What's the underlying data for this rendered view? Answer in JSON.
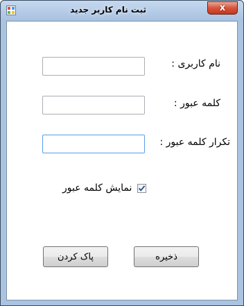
{
  "window": {
    "title": "ثبت نام کاربر جدید",
    "close_glyph": "x",
    "icon": "app-window-icon"
  },
  "form": {
    "username_label": "نام کاربری :",
    "username_value": "",
    "password_label": "کلمه عبور :",
    "password_value": "",
    "confirm_label": "تکرار کلمه عبور :",
    "confirm_value": "",
    "show_password_label": "نمایش کلمه عبور",
    "show_password_checked": true
  },
  "buttons": {
    "save_label": "ذخیره",
    "clear_label": "پاک کردن"
  },
  "colors": {
    "frame": "#a9c4e2",
    "close_button": "#c4381e",
    "focus_border": "#569de5"
  }
}
